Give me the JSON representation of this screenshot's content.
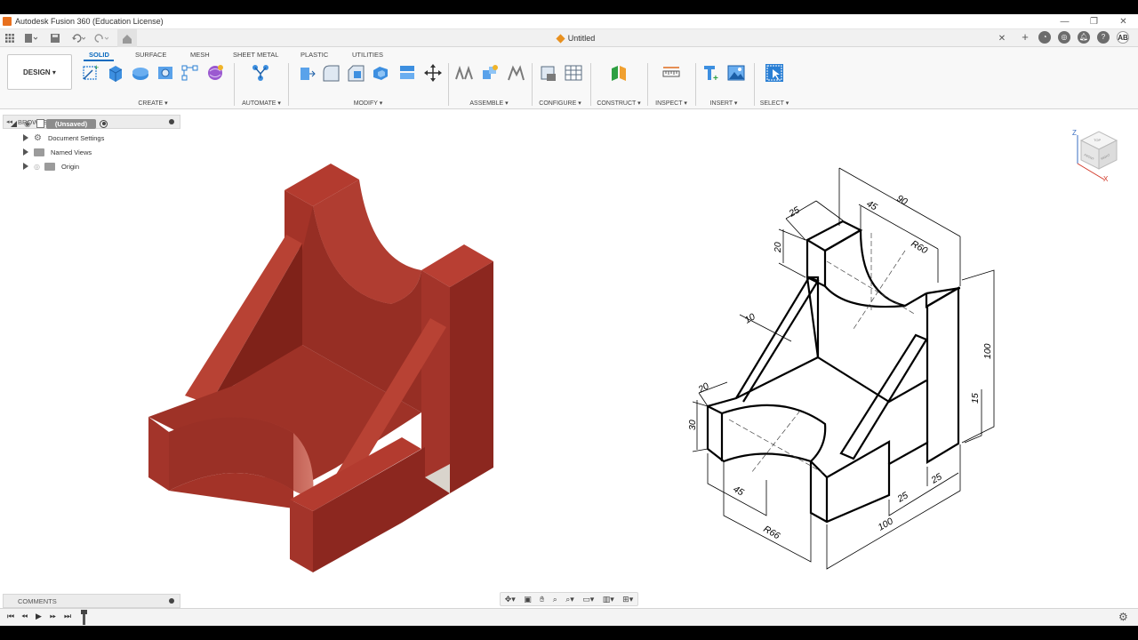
{
  "window": {
    "title": "Autodesk Fusion 360 (Education License)",
    "controls": {
      "minimize": "—",
      "maximize": "❐",
      "close": "✕"
    }
  },
  "document": {
    "tab_title": "Untitled",
    "user_initials": "AB"
  },
  "ribbon": {
    "workspace": "DESIGN ▾",
    "tabs": [
      "SOLID",
      "SURFACE",
      "MESH",
      "SHEET METAL",
      "PLASTIC",
      "UTILITIES"
    ],
    "active_tab": "SOLID",
    "groups": {
      "create": "CREATE ▾",
      "automate": "AUTOMATE ▾",
      "modify": "MODIFY ▾",
      "assemble": "ASSEMBLE ▾",
      "configure": "CONFIGURE ▾",
      "construct": "CONSTRUCT ▾",
      "inspect": "INSPECT ▾",
      "insert": "INSERT ▾",
      "select": "SELECT ▾"
    }
  },
  "browser": {
    "header": "BROWSER",
    "root": "(Unsaved)",
    "items": [
      "Document Settings",
      "Named Views",
      "Origin"
    ]
  },
  "comments": {
    "header": "COMMENTS"
  },
  "viewcube": {
    "axis_z": "Z",
    "axis_x": "X",
    "face_top": "TOP",
    "face_front": "FRONT",
    "face_right": "RIGHT"
  },
  "drawing": {
    "dims": {
      "d90": "90",
      "d45_top": "45",
      "d25_top": "25",
      "d20_top": "20",
      "r60": "R60",
      "d10": "10",
      "d100_right": "100",
      "d15": "15",
      "d20_left": "20",
      "d30": "30",
      "d45_bottom": "45",
      "r66": "R66",
      "d100_bottom": "100",
      "d25_a": "25",
      "d25_b": "25"
    }
  },
  "colors": {
    "model": "#a8362a",
    "model_dark": "#7f2219",
    "model_light": "#b84234",
    "accent": "#0a6bbf"
  }
}
